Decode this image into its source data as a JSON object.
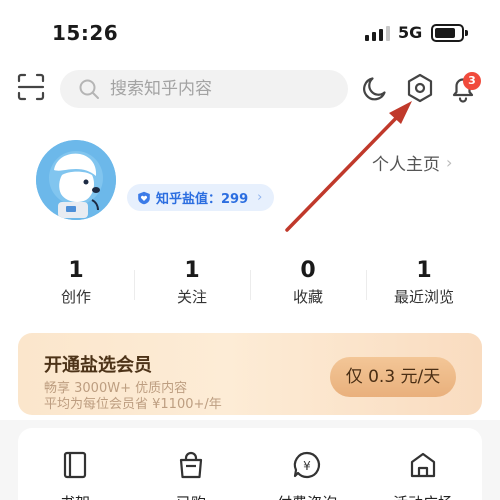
{
  "status_bar": {
    "time": "15:26",
    "network": "5G",
    "signal_bars_active": 3,
    "signal_bars_total": 4,
    "battery_fraction": 0.8
  },
  "header": {
    "scan_icon": "scan-icon",
    "search_icon": "search-icon",
    "search_placeholder": "搜索知乎内容",
    "dark_mode_icon": "moon-icon",
    "settings_icon": "settings-hexagon-icon",
    "notification_icon": "bell-icon",
    "notification_count": "3"
  },
  "profile": {
    "avatar_icon": "astronaut-dog-avatar",
    "salt_label": "知乎盐值：299",
    "salt_chevron": "›",
    "homepage_label": "个人主页",
    "homepage_chevron": "›"
  },
  "stats": [
    {
      "value": "1",
      "label": "创作"
    },
    {
      "value": "1",
      "label": "关注"
    },
    {
      "value": "0",
      "label": "收藏"
    },
    {
      "value": "1",
      "label": "最近浏览"
    }
  ],
  "vip_banner": {
    "title": "开通盐选会员",
    "line1": "畅享 3000W+ 优质内容",
    "line2": "平均为每位会员省 ¥1100+/年",
    "price_button": "仅 0.3 元/天"
  },
  "tools": [
    {
      "label": "书架",
      "icon": "bookshelf-icon"
    },
    {
      "label": "已购",
      "icon": "shopping-bag-icon"
    },
    {
      "label": "付费咨询",
      "icon": "paid-consult-icon"
    },
    {
      "label": "活动广场",
      "icon": "activity-square-icon"
    }
  ],
  "colors": {
    "accent_blue": "#2c6ee0",
    "badge_red": "#f04b3c",
    "vip_gold": "#e9b07c",
    "annotation_arrow": "#c0392b"
  }
}
